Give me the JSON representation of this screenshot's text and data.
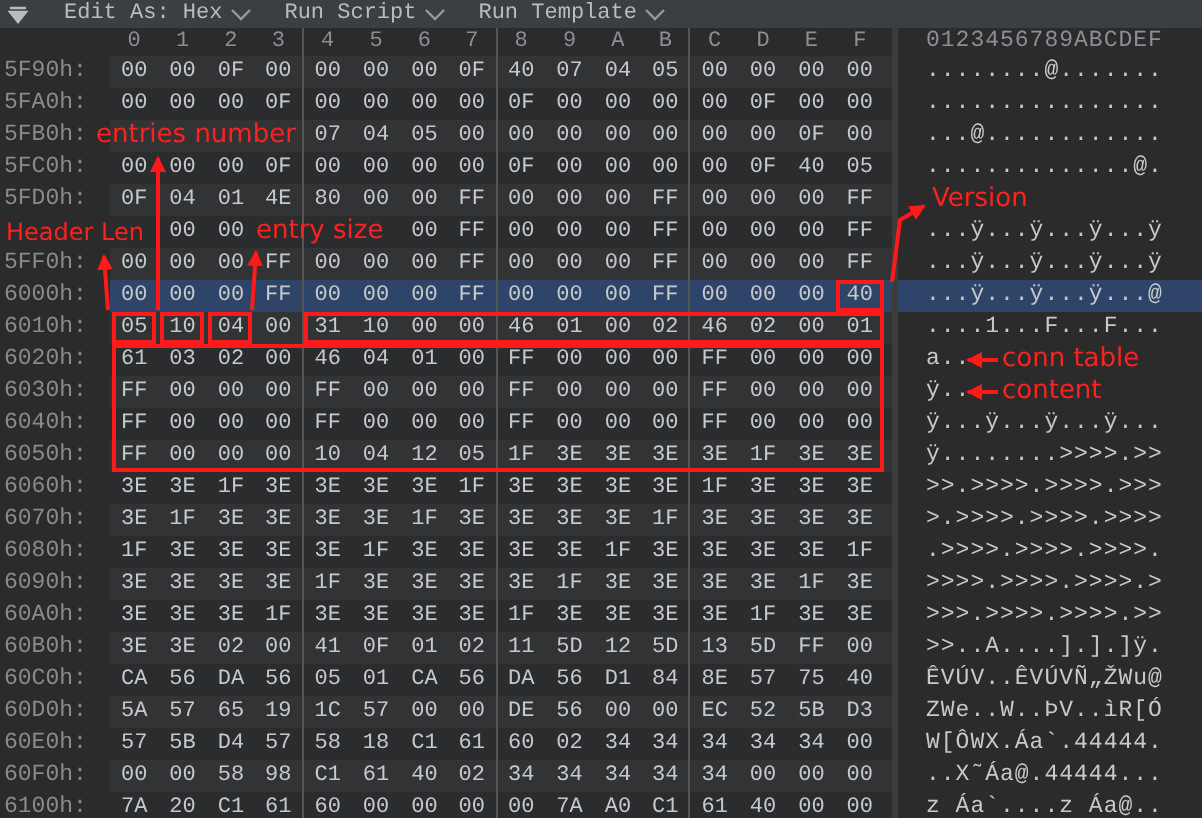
{
  "toolbar": {
    "items": [
      {
        "label": "Edit As: Hex"
      },
      {
        "label": "Run Script"
      },
      {
        "label": "Run Template"
      }
    ]
  },
  "columns": [
    "0",
    "1",
    "2",
    "3",
    "4",
    "5",
    "6",
    "7",
    "8",
    "9",
    "A",
    "B",
    "C",
    "D",
    "E",
    "F"
  ],
  "ascii_header": "0123456789ABCDEF",
  "rows": [
    {
      "address": "5F90h:",
      "bytes": [
        "00",
        "00",
        "0F",
        "00",
        "00",
        "00",
        "00",
        "0F",
        "40",
        "07",
        "04",
        "05",
        "00",
        "00",
        "00",
        "00"
      ],
      "ascii": "........@.......",
      "selected": false
    },
    {
      "address": "5FA0h:",
      "bytes": [
        "00",
        "00",
        "00",
        "0F",
        "00",
        "00",
        "00",
        "00",
        "0F",
        "00",
        "00",
        "00",
        "00",
        "0F",
        "00",
        "00"
      ],
      "ascii": "................",
      "selected": false
    },
    {
      "address": "5FB0h:",
      "bytes": [
        "07",
        "04",
        "05",
        "00",
        "00",
        "00",
        "00",
        "00",
        "00",
        "00",
        "0F",
        "00"
      ],
      "ascii": "...@............",
      "selected": false
    },
    {
      "address": "5FC0h:",
      "bytes": [
        "00",
        "00",
        "00",
        "0F",
        "00",
        "00",
        "00",
        "00",
        "0F",
        "00",
        "00",
        "00",
        "00",
        "0F",
        "40",
        "05"
      ],
      "ascii": "..............@.",
      "selected": false
    },
    {
      "address": "5FD0h:",
      "bytes": [
        "0F",
        "04",
        "01",
        "4E",
        "80",
        "00",
        "00",
        "FF",
        "00",
        "00",
        "00",
        "FF",
        "00",
        "00",
        "00",
        "FF"
      ],
      "selected": false
    },
    {
      "bytes": [
        "00",
        "00",
        "00",
        "FF",
        "00",
        "00",
        "00",
        "FF",
        "00",
        "00",
        "00",
        "FF"
      ],
      "ascii": "...ÿ...ÿ...ÿ...ÿ",
      "selected": false
    },
    {
      "address": "5FF0h:",
      "bytes": [
        "00",
        "00",
        "00",
        "FF",
        "00",
        "00",
        "00",
        "FF",
        "00",
        "00",
        "00",
        "FF",
        "00",
        "00",
        "00",
        "FF"
      ],
      "ascii": "...ÿ...ÿ...ÿ...ÿ",
      "selected": false
    },
    {
      "address": "6000h:",
      "bytes": [
        "00",
        "00",
        "00",
        "FF",
        "00",
        "00",
        "00",
        "FF",
        "00",
        "00",
        "00",
        "FF",
        "00",
        "00",
        "00",
        "40"
      ],
      "ascii": "...ÿ...ÿ...ÿ...@",
      "selected": true
    },
    {
      "address": "6010h:",
      "bytes": [
        "05",
        "10",
        "04",
        "00",
        "31",
        "10",
        "00",
        "00",
        "46",
        "01",
        "00",
        "02",
        "46",
        "02",
        "00",
        "01"
      ],
      "ascii": "....1...F...F...",
      "selected": false
    },
    {
      "address": "6020h:",
      "bytes": [
        "61",
        "03",
        "02",
        "00",
        "46",
        "04",
        "01",
        "00",
        "FF",
        "00",
        "00",
        "00",
        "FF",
        "00",
        "00",
        "00"
      ],
      "ascii": "a..",
      "selected": false
    },
    {
      "address": "6030h:",
      "bytes": [
        "FF",
        "00",
        "00",
        "00",
        "FF",
        "00",
        "00",
        "00",
        "FF",
        "00",
        "00",
        "00",
        "FF",
        "00",
        "00",
        "00"
      ],
      "ascii": "ÿ..",
      "selected": false
    },
    {
      "address": "6040h:",
      "bytes": [
        "FF",
        "00",
        "00",
        "00",
        "FF",
        "00",
        "00",
        "00",
        "FF",
        "00",
        "00",
        "00",
        "FF",
        "00",
        "00",
        "00"
      ],
      "ascii": "ÿ...ÿ...ÿ...ÿ...",
      "selected": false
    },
    {
      "address": "6050h:",
      "bytes": [
        "FF",
        "00",
        "00",
        "00",
        "10",
        "04",
        "12",
        "05",
        "1F",
        "3E",
        "3E",
        "3E",
        "3E",
        "1F",
        "3E",
        "3E"
      ],
      "ascii": "ÿ........>>>>.>>",
      "selected": false
    },
    {
      "address": "6060h:",
      "bytes": [
        "3E",
        "3E",
        "1F",
        "3E",
        "3E",
        "3E",
        "3E",
        "1F",
        "3E",
        "3E",
        "3E",
        "3E",
        "1F",
        "3E",
        "3E",
        "3E"
      ],
      "ascii": ">>.>>>>.>>>>.>>>",
      "selected": false
    },
    {
      "address": "6070h:",
      "bytes": [
        "3E",
        "1F",
        "3E",
        "3E",
        "3E",
        "3E",
        "1F",
        "3E",
        "3E",
        "3E",
        "3E",
        "1F",
        "3E",
        "3E",
        "3E",
        "3E"
      ],
      "ascii": ">.>>>>.>>>>.>>>>",
      "selected": false
    },
    {
      "address": "6080h:",
      "bytes": [
        "1F",
        "3E",
        "3E",
        "3E",
        "3E",
        "1F",
        "3E",
        "3E",
        "3E",
        "3E",
        "1F",
        "3E",
        "3E",
        "3E",
        "3E",
        "1F"
      ],
      "ascii": ".>>>>.>>>>.>>>>.",
      "selected": false
    },
    {
      "address": "6090h:",
      "bytes": [
        "3E",
        "3E",
        "3E",
        "3E",
        "1F",
        "3E",
        "3E",
        "3E",
        "3E",
        "1F",
        "3E",
        "3E",
        "3E",
        "3E",
        "1F",
        "3E"
      ],
      "ascii": ">>>>.>>>>.>>>>.>",
      "selected": false
    },
    {
      "address": "60A0h:",
      "bytes": [
        "3E",
        "3E",
        "3E",
        "1F",
        "3E",
        "3E",
        "3E",
        "3E",
        "1F",
        "3E",
        "3E",
        "3E",
        "3E",
        "1F",
        "3E",
        "3E"
      ],
      "ascii": ">>>.>>>>.>>>>.>>",
      "selected": false
    },
    {
      "address": "60B0h:",
      "bytes": [
        "3E",
        "3E",
        "02",
        "00",
        "41",
        "0F",
        "01",
        "02",
        "11",
        "5D",
        "12",
        "5D",
        "13",
        "5D",
        "FF",
        "00"
      ],
      "ascii": ">>..A....].].]ÿ.",
      "selected": false
    },
    {
      "address": "60C0h:",
      "bytes": [
        "CA",
        "56",
        "DA",
        "56",
        "05",
        "01",
        "CA",
        "56",
        "DA",
        "56",
        "D1",
        "84",
        "8E",
        "57",
        "75",
        "40"
      ],
      "ascii": "ÊVÚV..ÊVÚVÑ„ŽWu@",
      "selected": false
    },
    {
      "address": "60D0h:",
      "bytes": [
        "5A",
        "57",
        "65",
        "19",
        "1C",
        "57",
        "00",
        "00",
        "DE",
        "56",
        "00",
        "00",
        "EC",
        "52",
        "5B",
        "D3"
      ],
      "ascii": "ZWe..W..ÞV..ìR[Ó",
      "selected": false
    },
    {
      "address": "60E0h:",
      "bytes": [
        "57",
        "5B",
        "D4",
        "57",
        "58",
        "18",
        "C1",
        "61",
        "60",
        "02",
        "34",
        "34",
        "34",
        "34",
        "34",
        "00"
      ],
      "ascii": "W[ÔWX.Áa`.44444.",
      "selected": false
    },
    {
      "address": "60F0h:",
      "bytes": [
        "00",
        "00",
        "58",
        "98",
        "C1",
        "61",
        "40",
        "02",
        "34",
        "34",
        "34",
        "34",
        "34",
        "00",
        "00",
        "00"
      ],
      "ascii": "..X˜Áa@.44444...",
      "selected": false
    },
    {
      "address": "6100h:",
      "bytes": [
        "7A",
        "20",
        "C1",
        "61",
        "60",
        "00",
        "00",
        "00",
        "00",
        "7A",
        "A0",
        "C1",
        "61",
        "40",
        "00",
        "00"
      ],
      "ascii": "z Áa`....z Áa@..",
      "selected": false
    }
  ],
  "annotations": [
    {
      "text": "entries number"
    },
    {
      "text": "Header Len"
    },
    {
      "text": "entry size"
    },
    {
      "text": "Version"
    },
    {
      "text": "conn table content"
    }
  ]
}
